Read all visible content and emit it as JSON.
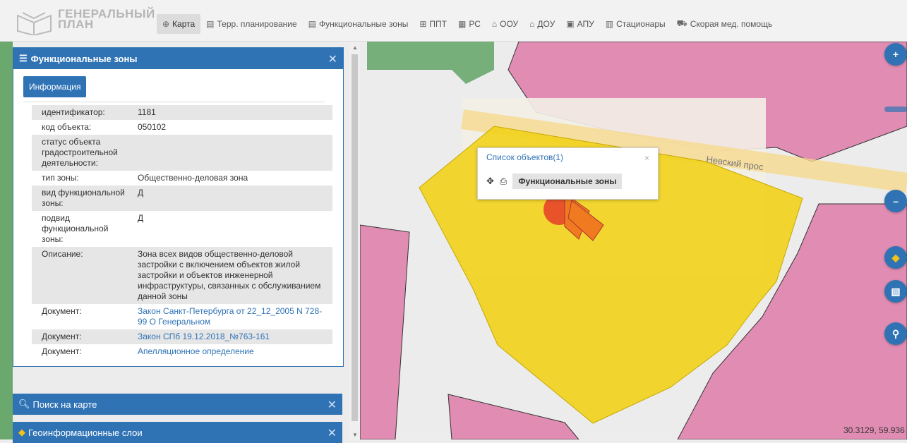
{
  "topbar": {
    "logo_text": "ГЕНЕРАЛЬНЫЙ ПЛАН",
    "nav": [
      {
        "icon": "globe-icon",
        "glyph": "⊕",
        "label": "Карта",
        "active": true
      },
      {
        "icon": "document-icon",
        "glyph": "▤",
        "label": "Терр. планирование"
      },
      {
        "icon": "list-icon",
        "glyph": "▤",
        "label": "Функциональные зоны"
      },
      {
        "icon": "grid-icon",
        "glyph": "⊞",
        "label": "ППТ"
      },
      {
        "icon": "table-icon",
        "glyph": "▦",
        "label": "РС"
      },
      {
        "icon": "school-icon",
        "glyph": "⌂",
        "label": "ООУ"
      },
      {
        "icon": "kindergarten-icon",
        "glyph": "⌂",
        "label": "ДОУ"
      },
      {
        "icon": "apu-icon",
        "glyph": "▣",
        "label": "АПУ"
      },
      {
        "icon": "hospital-icon",
        "glyph": "▥",
        "label": "Стационары"
      },
      {
        "icon": "ambulance-icon",
        "glyph": "⛟",
        "label": "Скорая мед. помощь"
      }
    ]
  },
  "panel": {
    "title": "Функциональные зоны",
    "info_button": "Информация",
    "rows": [
      {
        "key": "идентификатор:",
        "value": "1181"
      },
      {
        "key": "код объекта:",
        "value": "050102"
      },
      {
        "key": "статус объекта градостроительной деятельности:",
        "value": ""
      },
      {
        "key": "тип зоны:",
        "value": "Общественно-деловая зона"
      },
      {
        "key": "вид функциональной зоны:",
        "value": "Д"
      },
      {
        "key": "подвид функциональной зоны:",
        "value": "Д"
      },
      {
        "key": "Описание:",
        "value": "Зона всех видов общественно-деловой застройки с включением объектов жилой застройки и объектов инженерной инфраструктуры, связанных с обслуживанием данной зоны"
      },
      {
        "key": "Документ:",
        "value": "Закон Санкт-Петербурга от 22_12_2005 N 728-99 О Генеральном",
        "link": true
      },
      {
        "key": "Документ:",
        "value": "Закон СПб 19.12.2018_№763-161",
        "link": true
      },
      {
        "key": "Документ:",
        "value": "Апелляционное определение",
        "link": true
      }
    ]
  },
  "search_panel": {
    "title": "Поиск на карте"
  },
  "layers_panel": {
    "title": "Геоинформационные слои"
  },
  "popup": {
    "title": "Список объектов(1)",
    "close": "×",
    "item": "Функциональные зоны"
  },
  "map": {
    "street_label": "Невский прос",
    "coordinates": "30.3129, 59.936"
  },
  "colors": {
    "accent": "#2f73b5",
    "zone_pink": "#e08cb3",
    "zone_green": "#6aa86e",
    "zone_yellow": "#f2d21a"
  }
}
